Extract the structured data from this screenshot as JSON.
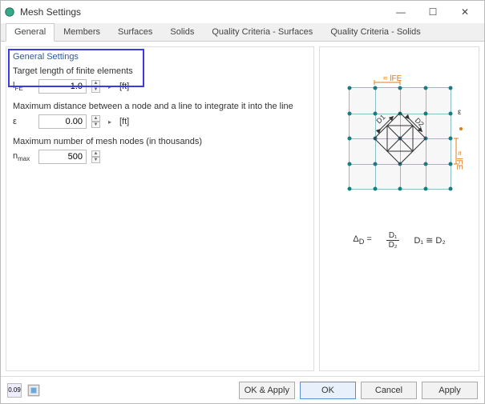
{
  "window": {
    "title": "Mesh Settings"
  },
  "titlebar_controls": {
    "min": "—",
    "max": "☐",
    "close": "✕"
  },
  "tabs": [
    "General",
    "Members",
    "Surfaces",
    "Solids",
    "Quality Criteria - Surfaces",
    "Quality Criteria - Solids"
  ],
  "group": {
    "header": "General Settings"
  },
  "fields": {
    "target": {
      "label": "Target length of finite elements",
      "symbol": "l",
      "sub": "FE",
      "value": "1.0",
      "unit": "[ft]"
    },
    "distance": {
      "label": "Maximum distance between a node and a line to integrate it into the line",
      "symbol": "ε",
      "sub": "",
      "value": "0.00",
      "unit": "[ft]"
    },
    "nodes": {
      "label": "Maximum number of mesh nodes (in thousands)",
      "symbol": "n",
      "sub": "max",
      "value": "500",
      "unit": ""
    }
  },
  "diagram": {
    "lfe_top": "≈ lFE",
    "lfe_right": "≈ lFE",
    "eps": "ε",
    "d1": "D1",
    "d2": "D2",
    "formula_lhs": "Δ",
    "formula_lhs_sub": "D",
    "formula_eq": "=",
    "frac_top": "D₁",
    "frac_bot": "D₂",
    "approx": "D₁ ≅ D₂"
  },
  "footer": {
    "val": "0.09",
    "ok_apply": "OK & Apply",
    "ok": "OK",
    "cancel": "Cancel",
    "apply": "Apply"
  }
}
